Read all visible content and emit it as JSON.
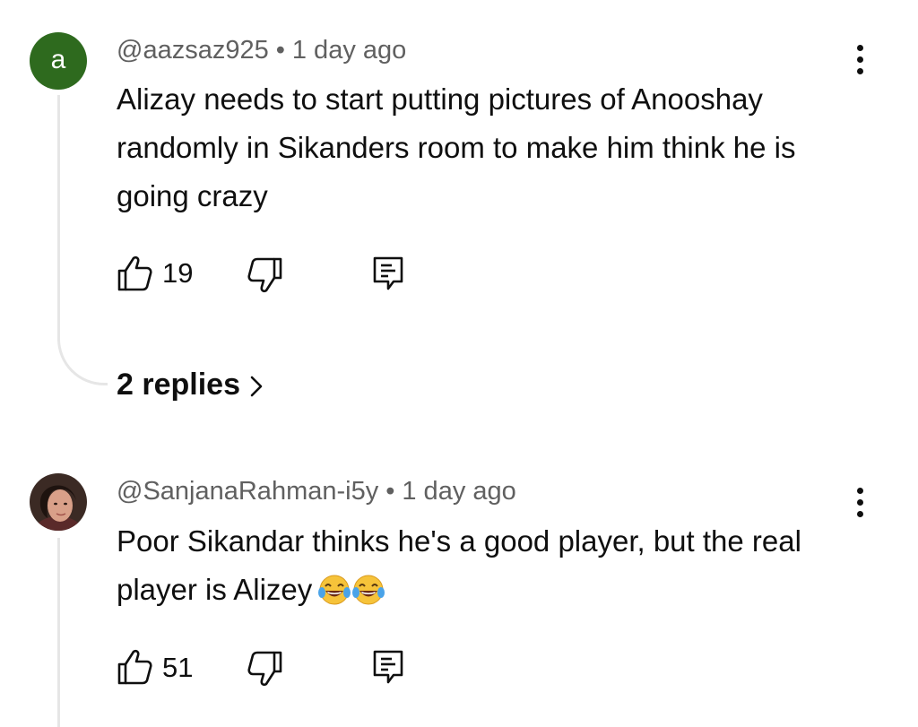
{
  "comments": [
    {
      "avatar_letter": "a",
      "avatar_color": "#2e6a1e",
      "handle": "@aazsaz925",
      "separator": "•",
      "time": "1 day ago",
      "text": "Alizay needs to start putting pictures of Anooshay randomly in Sikanders room to make him think he is going crazy",
      "likes": "19",
      "replies_label": "2 replies"
    },
    {
      "avatar_letter": "",
      "handle": "@SanjanaRahman-i5y",
      "separator": "•",
      "time": "1 day ago",
      "text": "Poor Sikandar thinks he's a good player, but the real player is Alizey",
      "emojis": [
        "face-with-tears-of-joy",
        "face-with-tears-of-joy"
      ],
      "likes": "51"
    }
  ],
  "icons": {
    "like": "thumbs-up-icon",
    "dislike": "thumbs-down-icon",
    "reply": "reply-comment-icon",
    "menu": "more-vertical-icon",
    "replies_chevron": "chevron-right-icon"
  },
  "colors": {
    "text": "#0f0f0f",
    "secondary_text": "#606060",
    "thread_line": "#e6e6e6"
  }
}
